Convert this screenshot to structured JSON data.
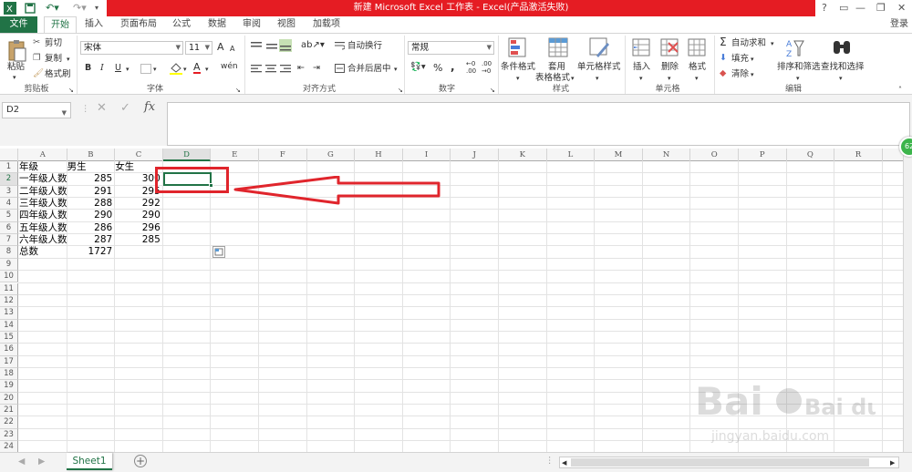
{
  "window": {
    "title": "新建 Microsoft Excel 工作表 - Excel(产品激活失败)",
    "help": "?",
    "minimize": "—",
    "restore": "❐",
    "close": "✕"
  },
  "tabs": [
    "文件",
    "开始",
    "插入",
    "页面布局",
    "公式",
    "数据",
    "审阅",
    "视图",
    "加载项"
  ],
  "login": "登录",
  "ribbon": {
    "clipboard": {
      "paste": "粘贴",
      "cut": "剪切",
      "copy": "复制",
      "format_painter": "格式刷",
      "label": "剪贴板"
    },
    "font": {
      "name": "宋体",
      "size": "11",
      "bold": "B",
      "italic": "I",
      "underline": "U",
      "grow": "A",
      "shrink": "A",
      "font_color": "A",
      "label": "字体"
    },
    "align": {
      "wrap": "自动换行",
      "merge": "合并后居中",
      "label": "对齐方式"
    },
    "number": {
      "format": "常规",
      "percent": "%",
      "comma": ",",
      "label": "数字"
    },
    "styles": {
      "cond": "条件格式",
      "table1": "套用",
      "table2": "表格格式",
      "cell": "单元格样式",
      "label": "样式"
    },
    "cells": {
      "insert": "插入",
      "delete": "删除",
      "format": "格式",
      "label": "单元格"
    },
    "edit": {
      "autosum": "自动求和",
      "fill": "填充",
      "clear": "清除",
      "sort": "排序和筛选",
      "find": "查找和选择",
      "label": "编辑"
    }
  },
  "formula_bar": {
    "name_box": "D2",
    "fx": "fx",
    "content": ""
  },
  "columns": [
    "A",
    "B",
    "C",
    "D",
    "E",
    "F",
    "G",
    "H",
    "I",
    "J",
    "K",
    "L",
    "M",
    "N",
    "O",
    "P",
    "Q",
    "R"
  ],
  "rows": [
    "1",
    "2",
    "3",
    "4",
    "5",
    "6",
    "7",
    "8",
    "9",
    "10",
    "11",
    "12",
    "13",
    "14",
    "15",
    "16",
    "17",
    "18",
    "19",
    "20",
    "21",
    "22",
    "23",
    "24"
  ],
  "cells": {
    "A1": "年级",
    "B1": "男生",
    "C1": "女生",
    "A2": "一年级人数",
    "B2": "285",
    "C2": "300",
    "A3": "二年级人数",
    "B3": "291",
    "C3": "295",
    "A4": "三年级人数",
    "B4": "288",
    "C4": "292",
    "A5": "四年级人数",
    "B5": "290",
    "C5": "290",
    "A6": "五年级人数",
    "B6": "286",
    "C6": "296",
    "A7": "六年级人数",
    "B7": "287",
    "C7": "285",
    "A8": "总数",
    "B8": "1727"
  },
  "selected_cell": "D2",
  "sheet_tab": "Sheet1",
  "badge": "62",
  "watermark": {
    "brand": "Bai du 经验",
    "url": "jingyan.baidu.com"
  },
  "colors": {
    "excel_green": "#217346",
    "title_red": "#e51c23",
    "annotation_red": "#e0252c"
  }
}
